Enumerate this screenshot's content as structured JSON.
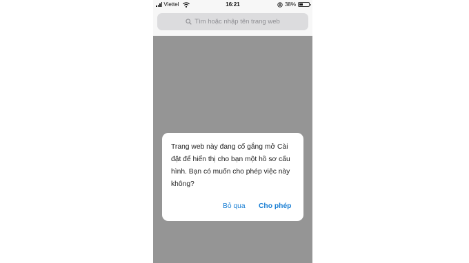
{
  "status_bar": {
    "carrier": "Viettel",
    "time": "16:21",
    "battery_percent": "38%",
    "battery_level": 0.38,
    "icons": [
      "signal-icon",
      "wifi-icon",
      "orientation-lock-icon",
      "battery-icon"
    ]
  },
  "search": {
    "placeholder": "Tìm hoặc nhập tên trang web",
    "icon": "search-icon"
  },
  "dialog": {
    "message": "Trang web này đang cố gắng mở Cài đặt để hiển thị cho bạn một hồ sơ cấu hình. Bạn có muốn cho phép việc này không?",
    "skip_label": "Bỏ qua",
    "allow_label": "Cho phép"
  },
  "colors": {
    "overlay": "#959595",
    "accent": "#1a7fd4",
    "search_bg": "#dcdcde"
  }
}
